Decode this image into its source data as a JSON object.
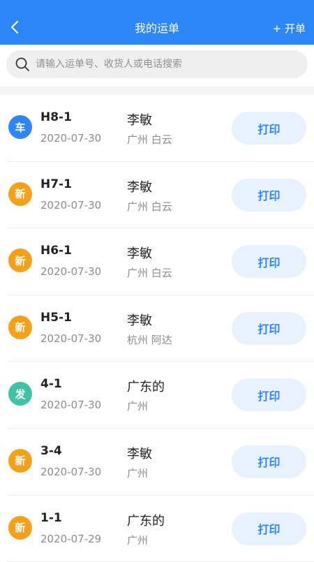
{
  "header": {
    "title": "我的运单",
    "new_label": "+ 开单"
  },
  "search": {
    "placeholder": "请输入运单号、收货人或电话搜索",
    "value": ""
  },
  "badge_colors": {
    "车": "#2c86f6",
    "新": "#f6a01a",
    "发": "#3fc3a7"
  },
  "orders": [
    {
      "badge": "车",
      "code": "H8-1",
      "date": "2020-07-30",
      "name": "李敏",
      "location": "广州 白云",
      "print_label": "打印"
    },
    {
      "badge": "新",
      "code": "H7-1",
      "date": "2020-07-30",
      "name": "李敏",
      "location": "广州 白云",
      "print_label": "打印"
    },
    {
      "badge": "新",
      "code": "H6-1",
      "date": "2020-07-30",
      "name": "李敏",
      "location": "广州 白云",
      "print_label": "打印"
    },
    {
      "badge": "新",
      "code": "H5-1",
      "date": "2020-07-30",
      "name": "李敏",
      "location": "杭州 阿达",
      "print_label": "打印"
    },
    {
      "badge": "发",
      "code": "4-1",
      "date": "2020-07-30",
      "name": "广东的",
      "location": "广州",
      "print_label": "打印"
    },
    {
      "badge": "新",
      "code": "3-4",
      "date": "2020-07-30",
      "name": "李敏",
      "location": "广州",
      "print_label": "打印"
    },
    {
      "badge": "新",
      "code": "1-1",
      "date": "2020-07-29",
      "name": "广东的",
      "location": "广州",
      "print_label": "打印"
    }
  ]
}
